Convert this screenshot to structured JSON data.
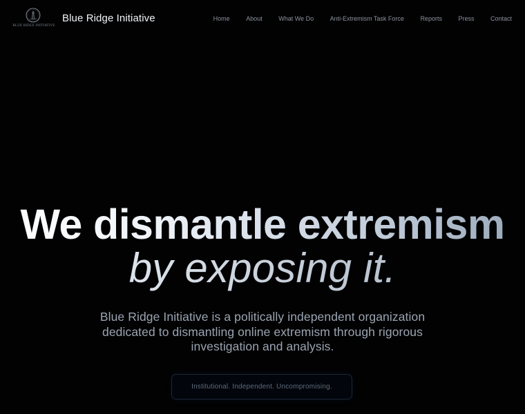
{
  "header": {
    "logo_text": "BLUE RIDGE INITIATIVE",
    "brand": "Blue Ridge Initiative",
    "nav": [
      {
        "label": "Home"
      },
      {
        "label": "About"
      },
      {
        "label": "What We Do"
      },
      {
        "label": "Anti-Extremism Task Force"
      },
      {
        "label": "Reports"
      },
      {
        "label": "Press"
      },
      {
        "label": "Contact"
      }
    ]
  },
  "hero": {
    "title": "We dismantle extremism",
    "subtitle": "by exposing it.",
    "description": "Blue Ridge Initiative is a politically independent organization dedicated to dismantling online extremism through rigorous investigation and analysis.",
    "tagline": "Institutional. Independent. Uncompromising."
  },
  "colors": {
    "background": "#020203",
    "nav_text": "#8c939e",
    "brand_text": "#f1f3f6",
    "tagline_border": "#1b2738"
  },
  "icons": {
    "logo_emblem": "lighthouse-emblem-icon"
  }
}
